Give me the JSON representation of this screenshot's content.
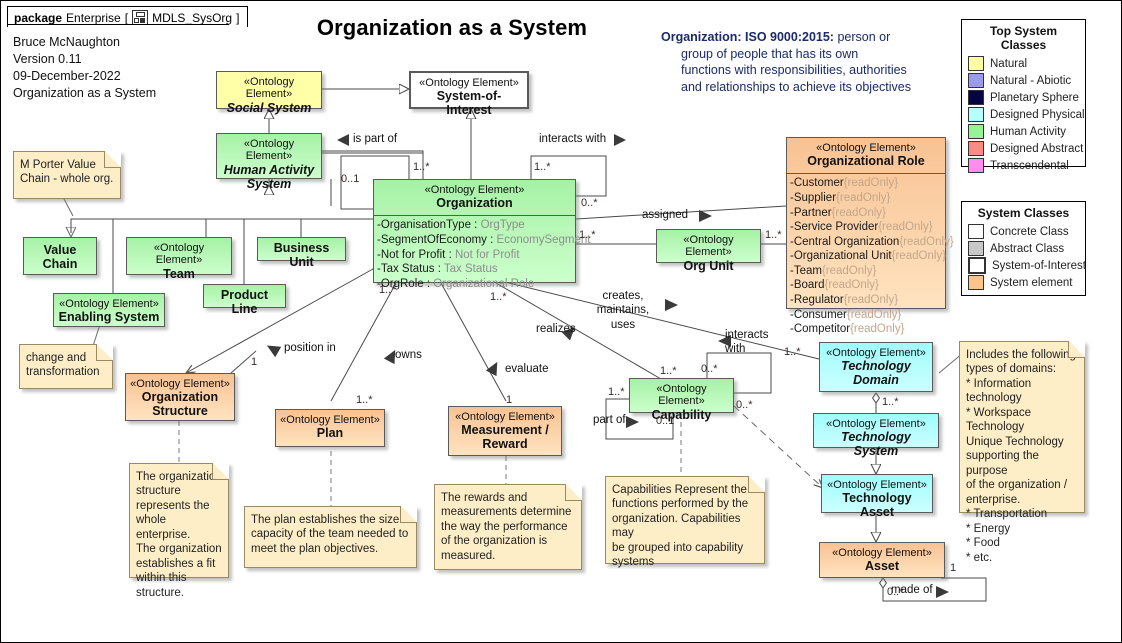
{
  "package": {
    "keyword": "package",
    "name": "Enterprise",
    "icon": "package-icon",
    "diagram": "MDLS_SysOrg",
    "open": "[",
    "close": "]"
  },
  "title": "Organization as a System",
  "meta": {
    "author": "Bruce McNaughton",
    "version": "Version 0.11",
    "date": "09-December-2022",
    "subject": "Organization as a System"
  },
  "iso_note": {
    "lead": "Organization:  ISO 9000:2015:",
    "rest": " person or",
    "lines": [
      "group of people that has its own",
      "functions with responsibilities, authorities",
      "and relationships to achieve its objectives"
    ]
  },
  "legends": {
    "top": {
      "title": "Top System Classes",
      "items": [
        {
          "label": "Natural",
          "color": "#ffffa8"
        },
        {
          "label": "Natural - Abiotic",
          "color": "#9a9aee"
        },
        {
          "label": "Planetary Sphere",
          "color": "#050545"
        },
        {
          "label": "Designed Physical",
          "color": "#b6ffff"
        },
        {
          "label": "Human Activity",
          "color": "#93f593"
        },
        {
          "label": "Designed Abstract",
          "color": "#f98b85"
        },
        {
          "label": "Transcendental",
          "color": "#ff8cf0"
        }
      ]
    },
    "classes": {
      "title": "System Classes",
      "items": [
        {
          "label": "Concrete Class",
          "color": "#ffffff"
        },
        {
          "label": "Abstract Class",
          "color": "#c8c8c8"
        },
        {
          "label": "System-of-Interest",
          "color": "#ffffff"
        },
        {
          "label": "System element",
          "color": "#fbc48a"
        }
      ]
    }
  },
  "stereotype": "«Ontology Element»",
  "nodes": {
    "social_system": {
      "stereo": "«Ontology Element»",
      "name": "Social System"
    },
    "system_of_interest": {
      "stereo": "«Ontology Element»",
      "name": "System-of-Interest"
    },
    "human_activity": {
      "stereo": "«Ontology Element»",
      "name": "Human Activity System"
    },
    "organization": {
      "stereo": "«Ontology Element»",
      "name": "Organization",
      "attributes": [
        {
          "name": "-OrganisationType : ",
          "type": "OrgType"
        },
        {
          "name": "-SegmentOfEconomy : ",
          "type": "EconomySegment"
        },
        {
          "name": "-Not for Profit : ",
          "type": "Not for Profit"
        },
        {
          "name": "-Tax Status : ",
          "type": "Tax Status"
        },
        {
          "name": "-OrgRole : ",
          "type": "Organizational Role"
        }
      ]
    },
    "org_role": {
      "stereo": "«Ontology Element»",
      "name": "Organizational Role",
      "attributes": [
        {
          "name": "-Customer",
          "type": "{readOnly}"
        },
        {
          "name": "-Supplier",
          "type": "{readOnly}"
        },
        {
          "name": "-Partner",
          "type": "{readOnly}"
        },
        {
          "name": "-Service Provider",
          "type": "{readOnly}"
        },
        {
          "name": "-Central Organization",
          "type": "{readOnly}"
        },
        {
          "name": "-Organizational Unit",
          "type": "{readOnly}"
        },
        {
          "name": "-Team",
          "type": "{readOnly}"
        },
        {
          "name": "-Board",
          "type": "{readOnly}"
        },
        {
          "name": "-Regulator",
          "type": "{readOnly}"
        },
        {
          "name": "-Consumer",
          "type": "{readOnly}"
        },
        {
          "name": "-Competitor",
          "type": "{readOnly}"
        }
      ]
    },
    "org_unit": {
      "stereo": "«Ontology Element»",
      "name": "Org Unit"
    },
    "value_chain": {
      "stereo": "",
      "name": "Value Chain"
    },
    "team": {
      "stereo": "«Ontology Element»",
      "name": "Team"
    },
    "business_unit": {
      "stereo": "",
      "name": "Business Unit"
    },
    "enabling_system": {
      "stereo": "«Ontology Element»",
      "name": "Enabling System"
    },
    "product_line": {
      "stereo": "",
      "name": "Product Line"
    },
    "org_structure": {
      "stereo": "«Ontology Element»",
      "name": "Organization Structure"
    },
    "plan": {
      "stereo": "«Ontology Element»",
      "name": "Plan"
    },
    "measurement": {
      "stereo": "«Ontology Element»",
      "name": "Measurement / Reward"
    },
    "capability": {
      "stereo": "«Ontology Element»",
      "name": "Capability"
    },
    "tech_domain": {
      "stereo": "«Ontology Element»",
      "name": "Technology Domain"
    },
    "tech_system": {
      "stereo": "«Ontology Element»",
      "name": "Technology System"
    },
    "tech_asset": {
      "stereo": "«Ontology Element»",
      "name": "Technology Asset"
    },
    "asset": {
      "stereo": "«Ontology Element»",
      "name": "Asset"
    }
  },
  "notes": {
    "porter": "M Porter Value\nChain - whole org.",
    "change": "change and\ntransformation",
    "org_structure": "The organization\nstructure\nrepresents the\nwhole enterprise.\nThe organization\nestablishes a fit\nwithin this\nstructure.",
    "plan": "The plan establishes the size /\ncapacity of the team needed to\nmeet the plan objectives.",
    "measurement": "The rewards and\nmeasurements determine\nthe way the performance\nof the organization is\nmeasured.",
    "capability": "Capabilities Represent the\nfunctions performed by the\norganization. Capabilities may\nbe grouped into capability\nsystems",
    "domains": "Includes the following\ntypes of domains:\n* Information technology\n* Workspace Technology\nUnique Technology\nsupporting the purpose\nof the organization /\nenterprise.\n* Transportation\n* Energy\n* Food\n* etc."
  },
  "edge_labels": {
    "is_part_of": "is part of",
    "interacts_with_top": "interacts with",
    "assigned": "assigned",
    "creates": "creates,\nmaintains,\nuses",
    "realizes": "realizes",
    "evaluate": "evaluate",
    "owns": "owns",
    "position_in": "position in",
    "part_of": "part of",
    "interacts_with_cap": "interacts\nwith",
    "made_of": "made of"
  },
  "multiplicities": {
    "m1": "0..1",
    "m2": "1..*",
    "m3": "1..*",
    "m4": "0..*",
    "m5": "1..*",
    "m6": "1..*",
    "m7": "1",
    "m8": "1..*",
    "m9": "1..*",
    "m10": "1",
    "m11": "1..*",
    "m12": "0..*",
    "m13": "1..*",
    "m14": "0..1",
    "m15": "1..*",
    "m16": "0..*",
    "m17": "1..*",
    "m18": "1..*",
    "m19": "1",
    "m20": "0..*"
  }
}
